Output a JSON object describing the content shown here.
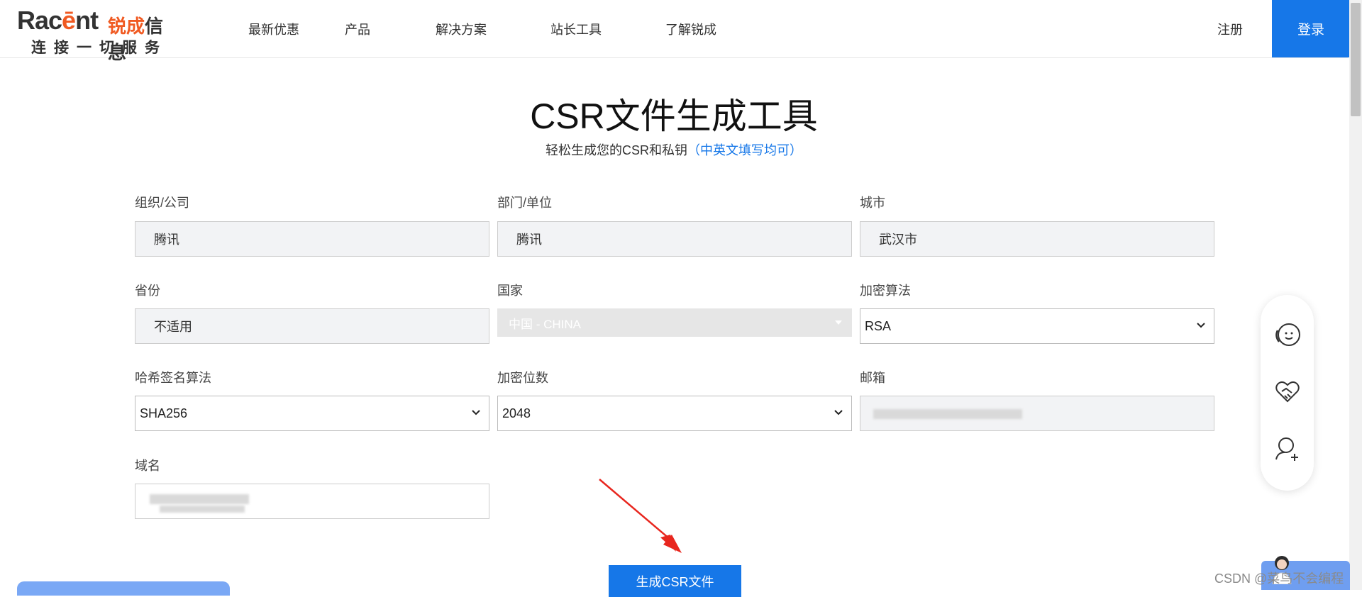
{
  "header": {
    "logo_main_prefix": "Rac",
    "logo_main_e": "ē",
    "logo_main_suffix": "nt",
    "logo_cn_brand": "锐成",
    "logo_cn_rest": "信息",
    "logo_slogan": "连接一切服务",
    "nav": [
      "最新优惠",
      "产品",
      "解决方案",
      "站长工具",
      "了解锐成"
    ],
    "register": "注册",
    "login": "登录"
  },
  "page": {
    "title": "CSR文件生成工具",
    "subtitle": "轻松生成您的CSR和私钥",
    "subtitle_hint": "（中英文填写均可）"
  },
  "form": {
    "org_label": "组织/公司",
    "org_value": "腾讯",
    "dept_label": "部门/单位",
    "dept_value": "腾讯",
    "city_label": "城市",
    "city_value": "武汉市",
    "province_label": "省份",
    "province_value": "不适用",
    "country_label": "国家",
    "country_value": "中国 - CHINA",
    "encrypt_label": "加密算法",
    "encrypt_value": "RSA",
    "hash_label": "哈希签名算法",
    "hash_value": "SHA256",
    "bits_label": "加密位数",
    "bits_value": "2048",
    "email_label": "邮箱",
    "domain_label": "域名",
    "submit": "生成CSR文件"
  },
  "footer": {
    "watermark": "CSDN @菜鸟不会编程"
  },
  "icons": [
    "phone-service-icon",
    "handshake-icon",
    "add-consultant-icon",
    "chevron-down-icon"
  ],
  "colors": {
    "accent": "#1677e8",
    "brand_orange": "#f05a22",
    "annotation_arrow": "#e8261e"
  }
}
